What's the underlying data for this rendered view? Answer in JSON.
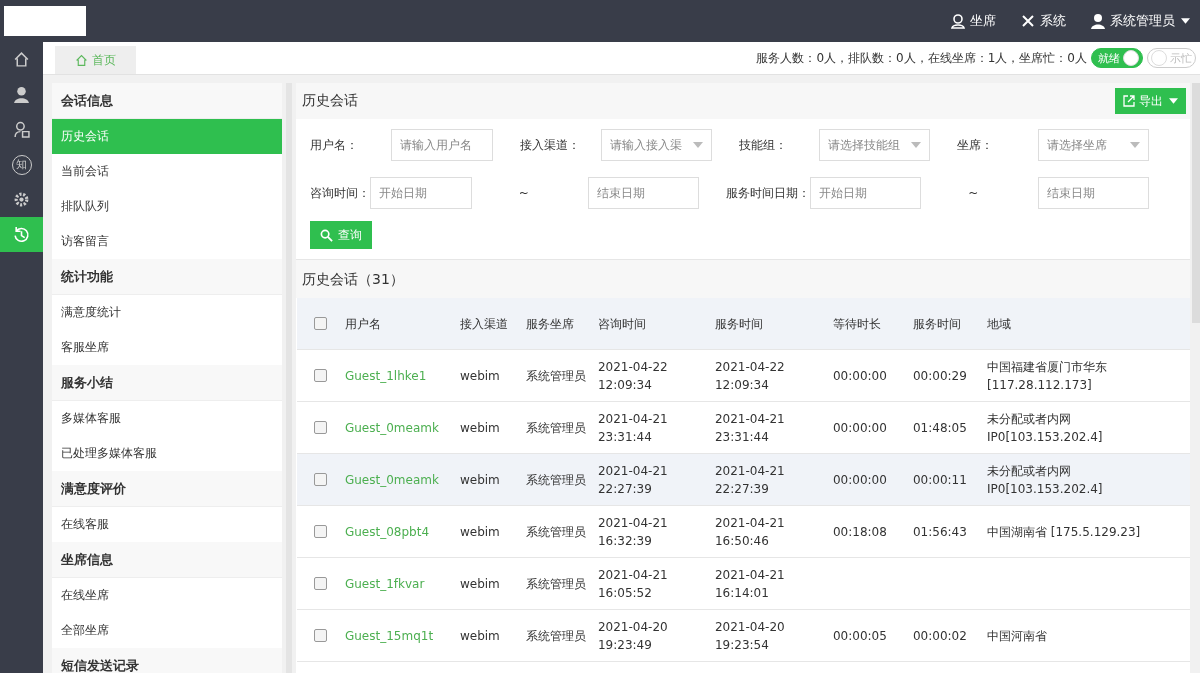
{
  "topbar": {
    "links": [
      {
        "kind": "agent",
        "label": "坐席"
      },
      {
        "kind": "system",
        "label": "系统"
      },
      {
        "kind": "user",
        "label": "系统管理员"
      }
    ]
  },
  "rail": [
    {
      "kind": "home",
      "selected": false
    },
    {
      "kind": "user",
      "selected": false
    },
    {
      "kind": "agent",
      "selected": false
    },
    {
      "kind": "knowledge",
      "label": "知",
      "selected": false
    },
    {
      "kind": "gear",
      "selected": false
    },
    {
      "kind": "history",
      "selected": true
    }
  ],
  "tabs": [
    {
      "label": "首页",
      "selected": true
    }
  ],
  "status": {
    "text": "服务人数：0人，排队数：0人，在线坐席：1人，坐席忙：0人",
    "toggles": [
      {
        "label": "就绪",
        "on": true
      },
      {
        "label": "示忙",
        "on": false
      }
    ]
  },
  "sidebar": [
    {
      "title": "会话信息",
      "items": [
        {
          "label": "历史会话",
          "selected": true
        },
        {
          "label": "当前会话",
          "selected": false
        },
        {
          "label": "排队队列",
          "selected": false
        },
        {
          "label": "访客留言",
          "selected": false
        }
      ]
    },
    {
      "title": "统计功能",
      "items": [
        {
          "label": "满意度统计",
          "selected": false
        },
        {
          "label": "客服坐席",
          "selected": false
        }
      ]
    },
    {
      "title": "服务小结",
      "items": [
        {
          "label": "多媒体客服",
          "selected": false
        },
        {
          "label": "已处理多媒体客服",
          "selected": false
        }
      ]
    },
    {
      "title": "满意度评价",
      "items": [
        {
          "label": "在线客服",
          "selected": false
        }
      ]
    },
    {
      "title": "坐席信息",
      "items": [
        {
          "label": "在线坐席",
          "selected": false
        },
        {
          "label": "全部坐席",
          "selected": false
        }
      ]
    },
    {
      "title": "短信发送记录"
    }
  ],
  "search": {
    "title": "历史会话",
    "export": "导出",
    "row1": [
      {
        "label": "用户名：",
        "kind": "input",
        "placeholder": "请输入用户名"
      },
      {
        "label": "接入渠道：",
        "kind": "select",
        "placeholder": "请输入接入渠"
      },
      {
        "label": "技能组：",
        "kind": "select",
        "placeholder": "请选择技能组"
      },
      {
        "label": "坐席：",
        "kind": "select",
        "placeholder": "请选择坐席"
      }
    ],
    "row2": [
      {
        "label": "咨询时间：",
        "kind": "input",
        "placeholder": "开始日期"
      },
      {
        "label": "~",
        "kind": "input",
        "placeholder": "结束日期"
      },
      {
        "label": "服务时间日期：",
        "kind": "input",
        "placeholder": "开始日期"
      },
      {
        "label": "~",
        "kind": "input",
        "placeholder": "结束日期"
      }
    ],
    "button": "查询"
  },
  "table": {
    "title": "历史会话（31）",
    "all_checked": false,
    "columns": [
      "用户名",
      "接入渠道",
      "服务坐席",
      "咨询时间",
      "服务时间",
      "等待时长",
      "服务时间",
      "地域"
    ],
    "rows": [
      {
        "selected": false,
        "checked": false,
        "cells": [
          "Guest_1lhke1",
          "webim",
          "系统管理员",
          "2021-04-22 12:09:34",
          "2021-04-22 12:09:34",
          "00:00:00",
          "00:00:29",
          "中国福建省厦门市华东 [117.28.112.173]"
        ]
      },
      {
        "selected": false,
        "checked": false,
        "cells": [
          "Guest_0meamk",
          "webim",
          "系统管理员",
          "2021-04-21 23:31:44",
          "2021-04-21 23:31:44",
          "00:00:00",
          "01:48:05",
          "未分配或者内网 IP0[103.153.202.4]"
        ]
      },
      {
        "selected": true,
        "checked": false,
        "cells": [
          "Guest_0meamk",
          "webim",
          "系统管理员",
          "2021-04-21 22:27:39",
          "2021-04-21 22:27:39",
          "00:00:00",
          "00:00:11",
          "未分配或者内网 IP0[103.153.202.4]"
        ]
      },
      {
        "selected": false,
        "checked": false,
        "cells": [
          "Guest_08pbt4",
          "webim",
          "系统管理员",
          "2021-04-21 16:32:39",
          "2021-04-21 16:50:46",
          "00:18:08",
          "01:56:43",
          "中国湖南省 [175.5.129.23]"
        ]
      },
      {
        "selected": false,
        "checked": false,
        "cells": [
          "Guest_1fkvar",
          "webim",
          "系统管理员",
          "2021-04-21 16:05:52",
          "2021-04-21 16:14:01"
        ]
      },
      {
        "selected": false,
        "checked": false,
        "cells": [
          "Guest_15mq1t",
          "webim",
          "系统管理员",
          "2021-04-20 19:23:49",
          "2021-04-20 19:23:54",
          "00:00:05",
          "00:00:02",
          "中国河南省"
        ]
      }
    ]
  }
}
